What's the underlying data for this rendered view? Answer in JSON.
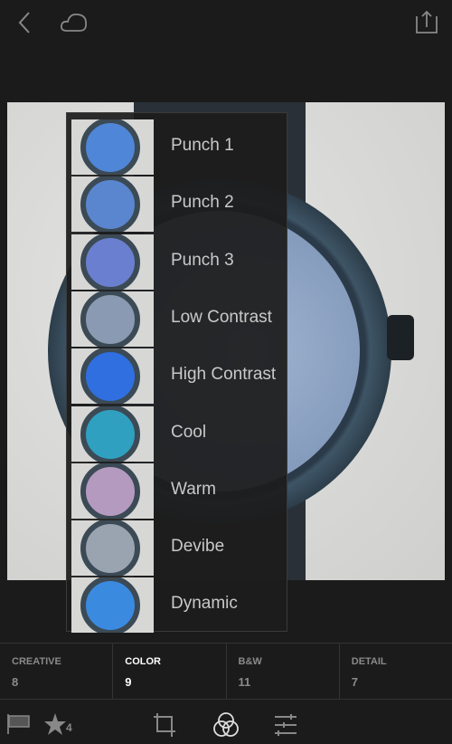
{
  "topbar": {
    "back_icon": "chevron-left",
    "cloud_icon": "cloud",
    "share_icon": "share-upload"
  },
  "presets": [
    {
      "label": "Punch 1",
      "tint": "#4f86d8"
    },
    {
      "label": "Punch 2",
      "tint": "#5a86cf"
    },
    {
      "label": "Punch 3",
      "tint": "#6a7fd0"
    },
    {
      "label": "Low Contrast",
      "tint": "#8a9ab2"
    },
    {
      "label": "High Contrast",
      "tint": "#2f6fe0"
    },
    {
      "label": "Cool",
      "tint": "#2fa0c0"
    },
    {
      "label": "Warm",
      "tint": "#b59ac0"
    },
    {
      "label": "Devibe",
      "tint": "#9aa4b0"
    },
    {
      "label": "Dynamic",
      "tint": "#3a8ae0"
    }
  ],
  "tabs": [
    {
      "name": "CREATIVE",
      "count": "8",
      "active": false
    },
    {
      "name": "COLOR",
      "count": "9",
      "active": true
    },
    {
      "name": "B&W",
      "count": "11",
      "active": false
    },
    {
      "name": "DETAIL",
      "count": "7",
      "active": false
    }
  ],
  "toolbar": {
    "rating": "4",
    "icons": [
      "flag",
      "star",
      "crop",
      "presets-circles",
      "adjust-sliders"
    ]
  }
}
